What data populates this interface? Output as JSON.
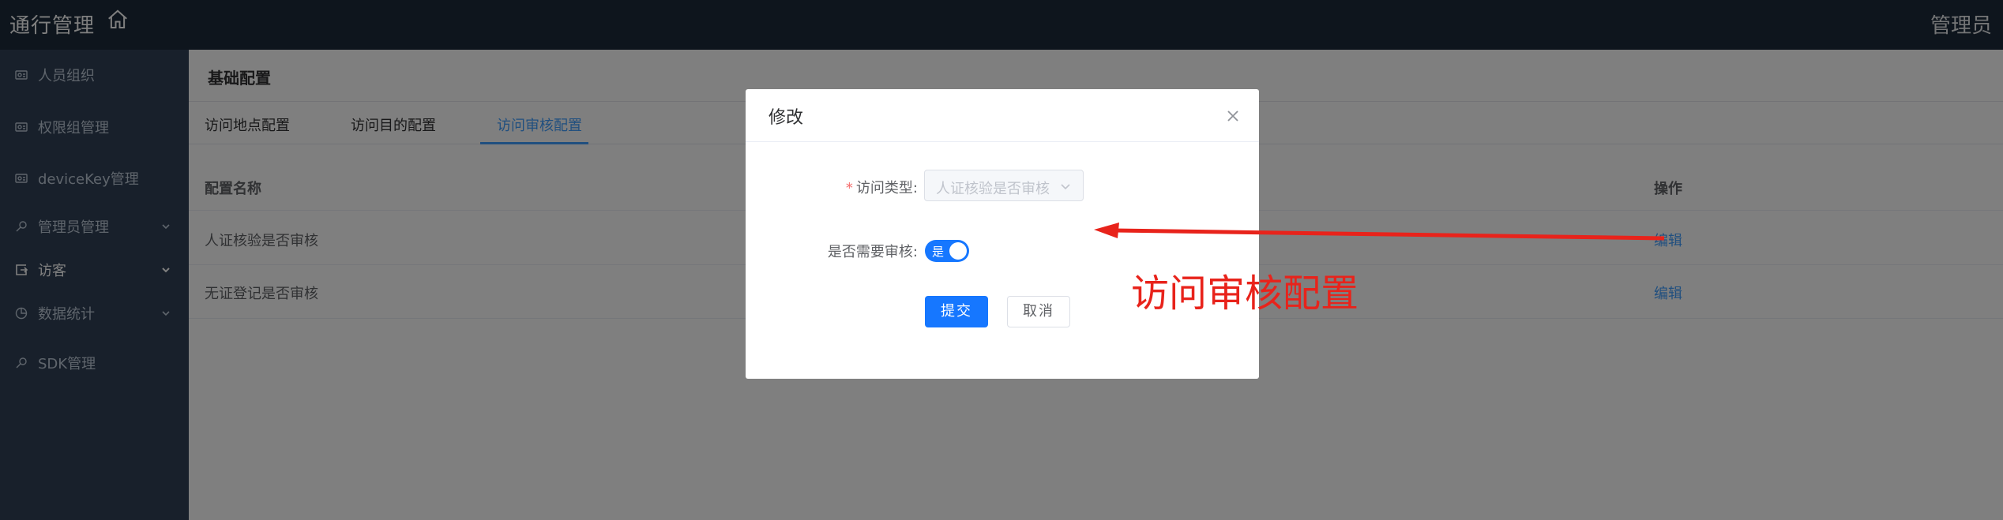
{
  "header": {
    "app_title": "通行管理",
    "user": "管理员"
  },
  "sidebar": {
    "items": [
      {
        "label": "人员组织",
        "icon": "id-card-icon"
      },
      {
        "label": "权限组管理",
        "icon": "id-card-icon"
      },
      {
        "label": "deviceKey管理",
        "icon": "id-card-icon"
      },
      {
        "label": "管理员管理",
        "icon": "key-icon",
        "expandable": true
      },
      {
        "label": "访客",
        "icon": "visitor-icon",
        "expandable": true,
        "active": true
      },
      {
        "label": "数据统计",
        "icon": "pie-chart-icon",
        "expandable": true
      },
      {
        "label": "SDK管理",
        "icon": "key-icon"
      }
    ]
  },
  "main": {
    "section_title": "基础配置",
    "tabs": [
      {
        "label": "访问地点配置"
      },
      {
        "label": "访问目的配置"
      },
      {
        "label": "访问审核配置",
        "active": true
      }
    ],
    "table": {
      "columns": [
        "配置名称",
        "操作"
      ],
      "rows": [
        {
          "name": "人证核验是否审核",
          "action": "编辑"
        },
        {
          "name": "无证登记是否审核",
          "action": "编辑"
        }
      ]
    }
  },
  "dialog": {
    "title": "修改",
    "visit_type_label": "访问类型:",
    "visit_type_value": "人证核验是否审核",
    "need_review_label": "是否需要审核:",
    "switch_text": "是",
    "switch_on": true,
    "submit_label": "提交",
    "cancel_label": "取消"
  },
  "annotation": {
    "text": "访问审核配置",
    "color": "#e8231b"
  },
  "colors": {
    "header_bg": "#1d2b3a",
    "sidebar_bg": "#304156",
    "accent": "#409eff",
    "primary_button": "#1677ff"
  }
}
